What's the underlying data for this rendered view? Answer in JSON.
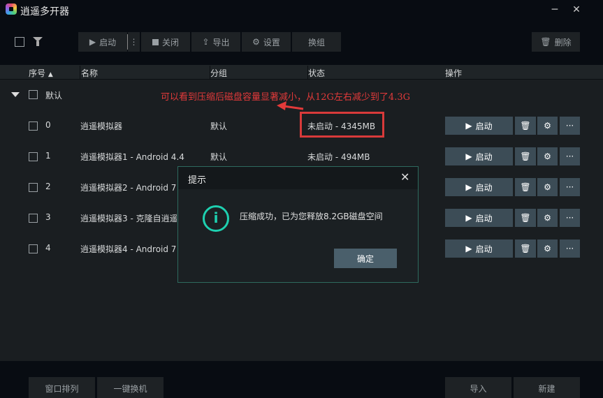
{
  "app": {
    "title": "逍遥多开器",
    "minimize": "─",
    "close": "✕"
  },
  "toolbar": {
    "start": "启动",
    "more": "⋮",
    "stop": "关闭",
    "export": "导出",
    "settings": "设置",
    "regroup": "换组",
    "delete": "删除"
  },
  "table": {
    "headers": {
      "index": "序号",
      "name": "名称",
      "group": "分组",
      "status": "状态",
      "actions": "操作"
    },
    "group_label": "默认",
    "rows": [
      {
        "index": "0",
        "name": "逍遥模拟器",
        "group": "默认",
        "status": "未启动 - 4345MB"
      },
      {
        "index": "1",
        "name": "逍遥模拟器1 - Android 4.4",
        "group": "默认",
        "status": "未启动 - 494MB"
      },
      {
        "index": "2",
        "name": "逍遥模拟器2 - Android 7",
        "group": "",
        "status": ""
      },
      {
        "index": "3",
        "name": "逍遥模拟器3 - 克隆自逍遥",
        "group": "",
        "status": ""
      },
      {
        "index": "4",
        "name": "逍遥模拟器4 - Android 7.",
        "group": "",
        "status": ""
      }
    ],
    "start_label": "启动",
    "more_label": "···"
  },
  "annotation": "可以看到压缩后磁盘容量显著减小，从12G左右减少到了4.3G",
  "dialog": {
    "title": "提示",
    "message": "压缩成功，已为您释放8.2GB磁盘空间",
    "confirm": "确定",
    "close": "✕"
  },
  "footer": {
    "arrange": "窗口排列",
    "switch": "一键换机",
    "import": "导入",
    "new": "新建"
  },
  "colors": {
    "accent": "#1ed0b0",
    "annotation": "#e23a3a",
    "button": "#3c4c56"
  }
}
